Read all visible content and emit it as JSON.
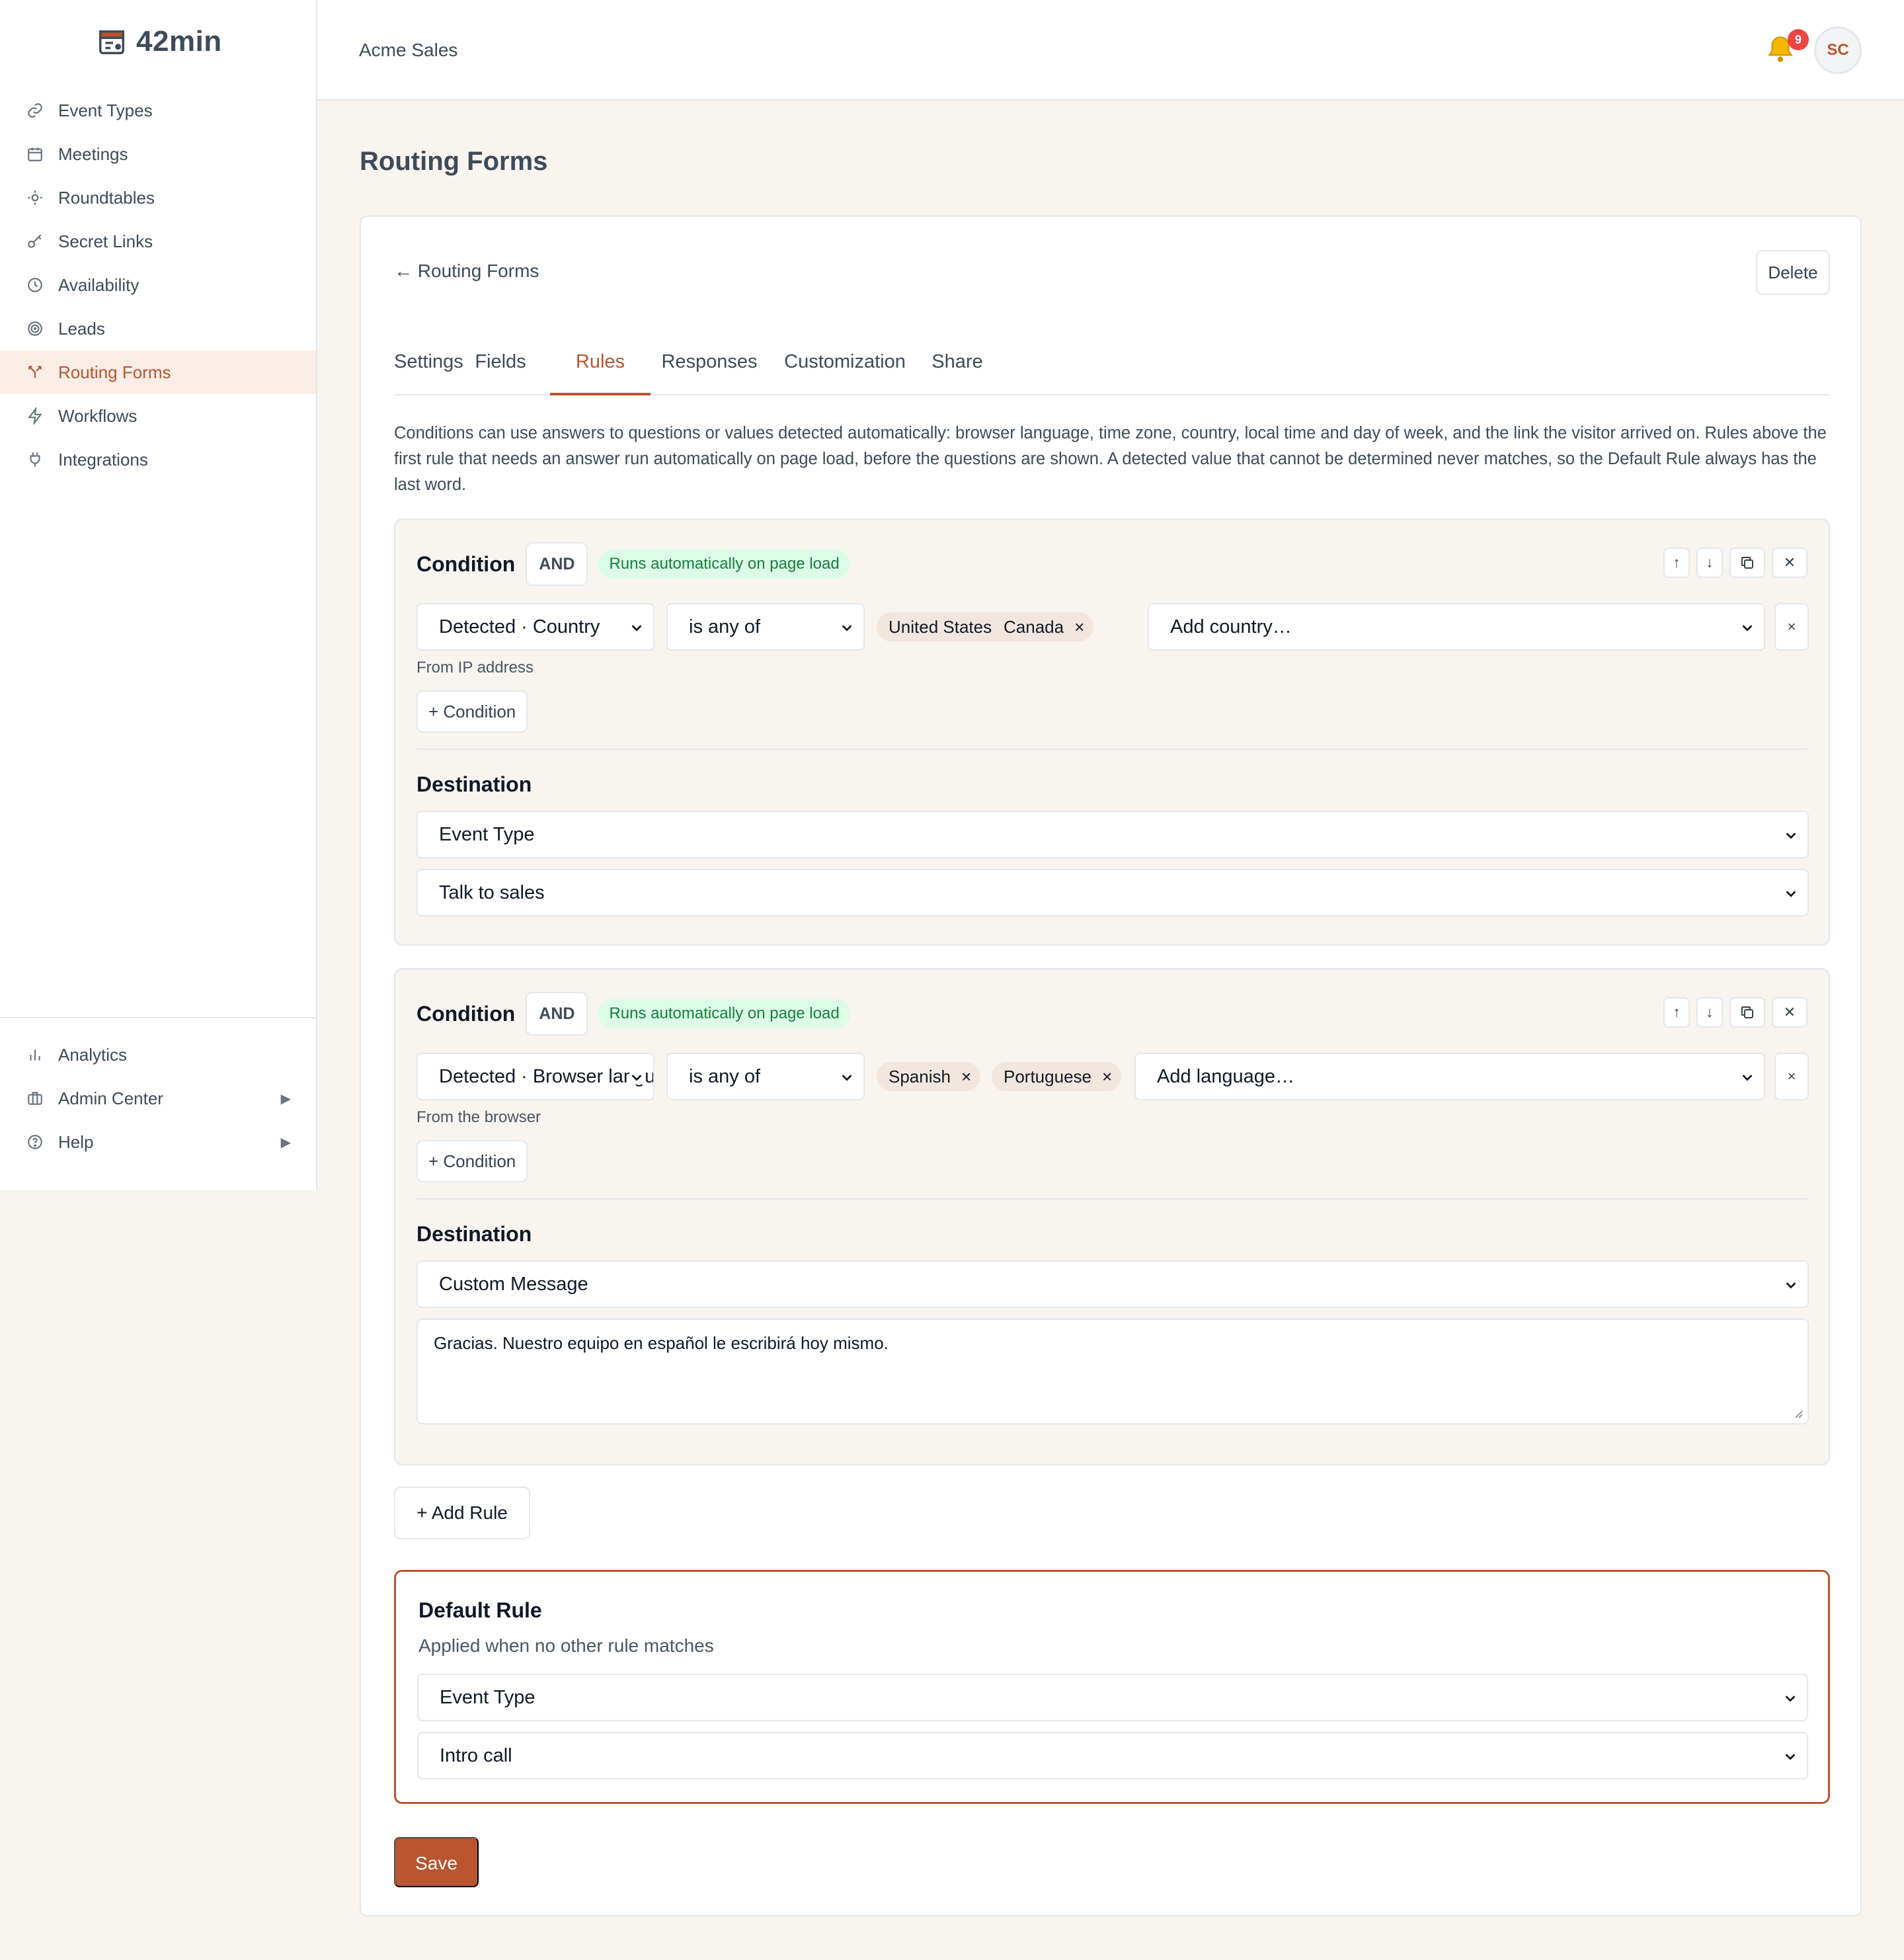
{
  "app": {
    "name": "42min",
    "org": "Acme Sales",
    "notifications": "9",
    "avatar_initials": "SC"
  },
  "sidebar": {
    "items": [
      {
        "label": "Event Types",
        "icon": "link-icon"
      },
      {
        "label": "Meetings",
        "icon": "calendar-icon"
      },
      {
        "label": "Roundtables",
        "icon": "roundtable-icon"
      },
      {
        "label": "Secret Links",
        "icon": "key-icon"
      },
      {
        "label": "Availability",
        "icon": "clock-icon"
      },
      {
        "label": "Leads",
        "icon": "target-icon"
      },
      {
        "label": "Routing Forms",
        "icon": "routing-icon",
        "active": true
      },
      {
        "label": "Workflows",
        "icon": "bolt-icon"
      },
      {
        "label": "Integrations",
        "icon": "plug-icon"
      }
    ],
    "bottom": [
      {
        "label": "Analytics",
        "icon": "chart-icon"
      },
      {
        "label": "Admin Center",
        "icon": "briefcase-icon",
        "caret": "▶"
      },
      {
        "label": "Help",
        "icon": "help-icon",
        "caret": "▶"
      }
    ]
  },
  "page": {
    "title": "Routing Forms",
    "back": "← Routing Forms",
    "delete": "Delete"
  },
  "tabs": [
    "Settings",
    "Fields",
    "Rules",
    "Responses",
    "Customization",
    "Share"
  ],
  "active_tab": "Rules",
  "intro": "Conditions can use answers to questions or values detected automatically: browser language, time zone, country, local time and day of week, and the link the visitor arrived on. Rules above the first rule that needs an answer run automatically on page load, before the questions are shown. A detected value that cannot be determined never matches, so the Default Rule always has the last word.",
  "rules": [
    {
      "title": "Condition",
      "logic": "AND",
      "badge": "Runs automatically on page load",
      "field": "Detected · Country",
      "operator": "is any of",
      "chips": [
        "United States",
        "Canada"
      ],
      "add_placeholder": "Add country…",
      "hint": "From IP address",
      "add_condition": "+ Condition",
      "destination_title": "Destination",
      "destination_type": "Event Type",
      "destination_value": "Talk to sales"
    },
    {
      "title": "Condition",
      "logic": "AND",
      "badge": "Runs automatically on page load",
      "field": "Detected · Browser language",
      "operator": "is any of",
      "chips": [
        "Spanish",
        "Portuguese"
      ],
      "add_placeholder": "Add language…",
      "hint": "From the browser",
      "add_condition": "+ Condition",
      "destination_title": "Destination",
      "destination_type": "Custom Message",
      "message": "Gracias. Nuestro equipo en español le escribirá hoy mismo."
    }
  ],
  "controls": {
    "up": "↑",
    "down": "↓",
    "remove": "✕",
    "row_remove": "×",
    "chip_remove": "×"
  },
  "add_rule": "+ Add Rule",
  "default_rule": {
    "title": "Default Rule",
    "subtitle": "Applied when no other rule matches",
    "type": "Event Type",
    "value": "Intro call"
  },
  "save": "Save",
  "colors": {
    "accent": "#b9552f",
    "success_bg": "#dcfce7",
    "success_text": "#15803d",
    "badge_red": "#ef4444"
  }
}
